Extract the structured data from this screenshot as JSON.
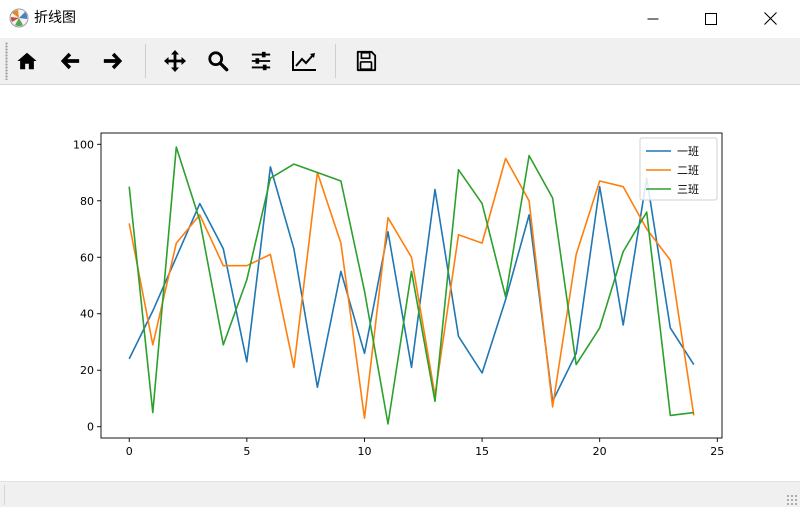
{
  "window": {
    "title": "折线图",
    "app_icon": "matplotlib-icon",
    "controls": [
      "minimize-icon",
      "maximize-icon",
      "close-icon"
    ]
  },
  "toolbar": {
    "buttons": [
      {
        "name": "home",
        "icon": "home-icon"
      },
      {
        "name": "back",
        "icon": "arrow-left-icon"
      },
      {
        "name": "forward",
        "icon": "arrow-right-icon"
      },
      {
        "name": "pan",
        "icon": "move-icon"
      },
      {
        "name": "zoom",
        "icon": "search-icon"
      },
      {
        "name": "subplots",
        "icon": "sliders-icon"
      },
      {
        "name": "edit-axis",
        "icon": "chart-line-icon"
      },
      {
        "name": "save",
        "icon": "save-icon"
      }
    ]
  },
  "colors": {
    "series_1": "#1f77b4",
    "series_2": "#ff7f0e",
    "series_3": "#2ca02c",
    "toolbar_bg": "#f0f0f0"
  },
  "chart_data": {
    "type": "line",
    "x": [
      0,
      1,
      2,
      3,
      4,
      5,
      6,
      7,
      8,
      9,
      10,
      11,
      12,
      13,
      14,
      15,
      16,
      17,
      18,
      19,
      20,
      21,
      22,
      23,
      24
    ],
    "series": [
      {
        "name": "一班",
        "color": "#1f77b4",
        "values": [
          24,
          41,
          60,
          79,
          63,
          23,
          92,
          63,
          14,
          55,
          26,
          69,
          21,
          84,
          32,
          19,
          45,
          75,
          9,
          26,
          85,
          36,
          88,
          35,
          22
        ]
      },
      {
        "name": "二班",
        "color": "#ff7f0e",
        "values": [
          72,
          29,
          65,
          75,
          57,
          57,
          61,
          21,
          90,
          65,
          3,
          74,
          60,
          11,
          68,
          65,
          95,
          80,
          7,
          61,
          87,
          85,
          70,
          59,
          4
        ]
      },
      {
        "name": "三班",
        "color": "#2ca02c",
        "values": [
          85,
          5,
          99,
          73,
          29,
          52,
          88,
          93,
          90,
          87,
          48,
          1,
          55,
          9,
          91,
          79,
          46,
          96,
          81,
          22,
          35,
          62,
          76,
          4,
          5
        ]
      }
    ],
    "xticks": [
      "0",
      "5",
      "10",
      "15",
      "20",
      "25"
    ],
    "yticks": [
      "0",
      "20",
      "40",
      "60",
      "80",
      "100"
    ],
    "xlim": [
      -1.2,
      25.2
    ],
    "ylim": [
      -4,
      104
    ],
    "grid": false,
    "legend_position": "top-right",
    "title": "",
    "xlabel": "",
    "ylabel": ""
  }
}
